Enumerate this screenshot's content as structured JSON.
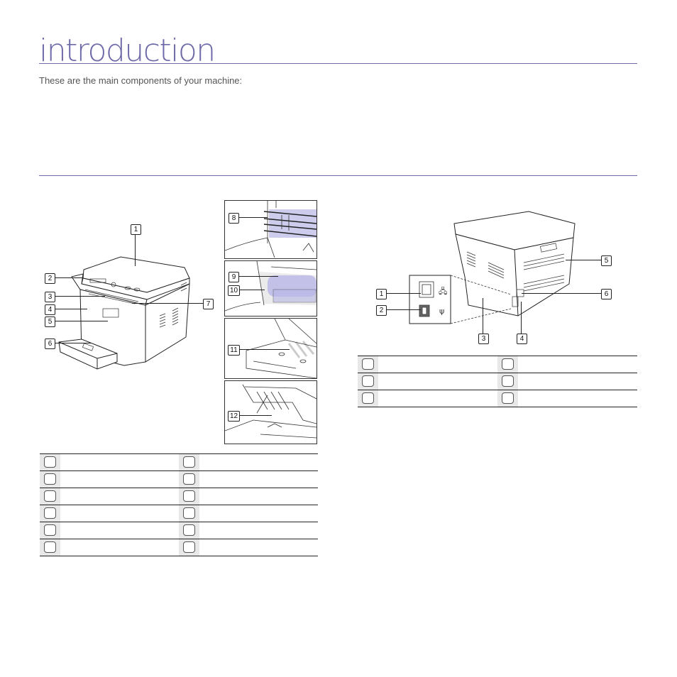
{
  "page": {
    "title": "introduction",
    "intro_text": "These are the main components of your machine:"
  },
  "front_view": {
    "callouts": [
      "1",
      "2",
      "3",
      "4",
      "5",
      "6",
      "7"
    ],
    "inset_callouts": [
      "8",
      "9",
      "10",
      "11",
      "12"
    ],
    "legend": [
      {
        "num": "",
        "label": ""
      },
      {
        "num": "",
        "label": ""
      },
      {
        "num": "",
        "label": ""
      },
      {
        "num": "",
        "label": ""
      },
      {
        "num": "",
        "label": ""
      },
      {
        "num": "",
        "label": ""
      },
      {
        "num": "",
        "label": ""
      },
      {
        "num": "",
        "label": ""
      },
      {
        "num": "",
        "label": ""
      },
      {
        "num": "",
        "label": ""
      },
      {
        "num": "",
        "label": ""
      },
      {
        "num": "",
        "label": ""
      }
    ]
  },
  "rear_view": {
    "callouts": [
      "1",
      "2",
      "3",
      "4",
      "5",
      "6"
    ],
    "legend": [
      {
        "num": "",
        "label": ""
      },
      {
        "num": "",
        "label": ""
      },
      {
        "num": "",
        "label": ""
      },
      {
        "num": "",
        "label": ""
      },
      {
        "num": "",
        "label": ""
      },
      {
        "num": "",
        "label": ""
      }
    ]
  },
  "colors": {
    "accent": "#6e6aa8",
    "cartridge_highlight": "#b9b6e6"
  }
}
